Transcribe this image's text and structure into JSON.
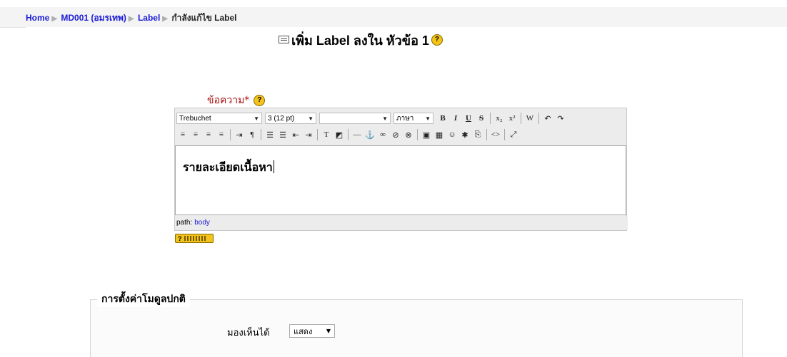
{
  "breadcrumb": {
    "home": "Home",
    "course": "MD001 (อมรเทพ)",
    "module": "Label",
    "current": "กำลังแก้ไข Label"
  },
  "page": {
    "title": "เพิ่ม Label ลงใน หัวข้อ 1",
    "help_glyph": "?"
  },
  "form": {
    "content_label": "ข้อความ*",
    "editor": {
      "font_family": "Trebuchet",
      "font_size": "3 (12 pt)",
      "format": "",
      "language": "ภาษา",
      "content_text": "รายละเอียดเนื้อหา",
      "path_label": "path:",
      "path_value": "body",
      "toolbar_row1": [
        {
          "name": "bold-icon",
          "glyph": "B"
        },
        {
          "name": "italic-icon",
          "glyph": "I"
        },
        {
          "name": "underline-icon",
          "glyph": "U"
        },
        {
          "name": "strikethrough-icon",
          "glyph": "S"
        },
        {
          "sep": true
        },
        {
          "name": "subscript-icon",
          "glyph": "x₂"
        },
        {
          "name": "superscript-icon",
          "glyph": "x²"
        },
        {
          "sep": true
        },
        {
          "name": "clean-word-icon",
          "glyph": "W"
        },
        {
          "sep": true
        },
        {
          "name": "undo-icon",
          "glyph": "↶"
        },
        {
          "name": "redo-icon",
          "glyph": "↷"
        }
      ],
      "toolbar_row2": [
        {
          "name": "align-left-icon",
          "glyph": "≡"
        },
        {
          "name": "align-center-icon",
          "glyph": "≡"
        },
        {
          "name": "align-right-icon",
          "glyph": "≡"
        },
        {
          "name": "justify-icon",
          "glyph": "≡"
        },
        {
          "sep": true
        },
        {
          "name": "ltr-icon",
          "glyph": "⇥"
        },
        {
          "name": "rtl-icon",
          "glyph": "¶"
        },
        {
          "sep": true
        },
        {
          "name": "ordered-list-icon",
          "glyph": "☰"
        },
        {
          "name": "unordered-list-icon",
          "glyph": "☰"
        },
        {
          "name": "outdent-icon",
          "glyph": "⇤"
        },
        {
          "name": "indent-icon",
          "glyph": "⇥"
        },
        {
          "sep": true
        },
        {
          "name": "text-color-icon",
          "glyph": "T"
        },
        {
          "name": "bg-color-icon",
          "glyph": "◩"
        },
        {
          "sep": true
        },
        {
          "name": "horizontal-rule-icon",
          "glyph": "—"
        },
        {
          "name": "anchor-icon",
          "glyph": "⚓"
        },
        {
          "name": "link-icon",
          "glyph": "∞"
        },
        {
          "name": "unlink-icon",
          "glyph": "⊘"
        },
        {
          "name": "nolink-icon",
          "glyph": "⊗"
        },
        {
          "sep": true
        },
        {
          "name": "image-icon",
          "glyph": "▣"
        },
        {
          "name": "table-icon",
          "glyph": "▦"
        },
        {
          "name": "smiley-icon",
          "glyph": "☺"
        },
        {
          "name": "special-char-icon",
          "glyph": "✱"
        },
        {
          "name": "search-replace-icon",
          "glyph": "⎘"
        },
        {
          "sep": true
        },
        {
          "name": "html-source-icon",
          "glyph": "<>"
        },
        {
          "sep": true
        },
        {
          "name": "fullscreen-icon",
          "glyph": "⤢"
        }
      ]
    }
  },
  "module_settings": {
    "legend": "การตั้งค่าโมดูลปกติ",
    "visible_label": "มองเห็นได้",
    "visible_value": "แสดง"
  }
}
